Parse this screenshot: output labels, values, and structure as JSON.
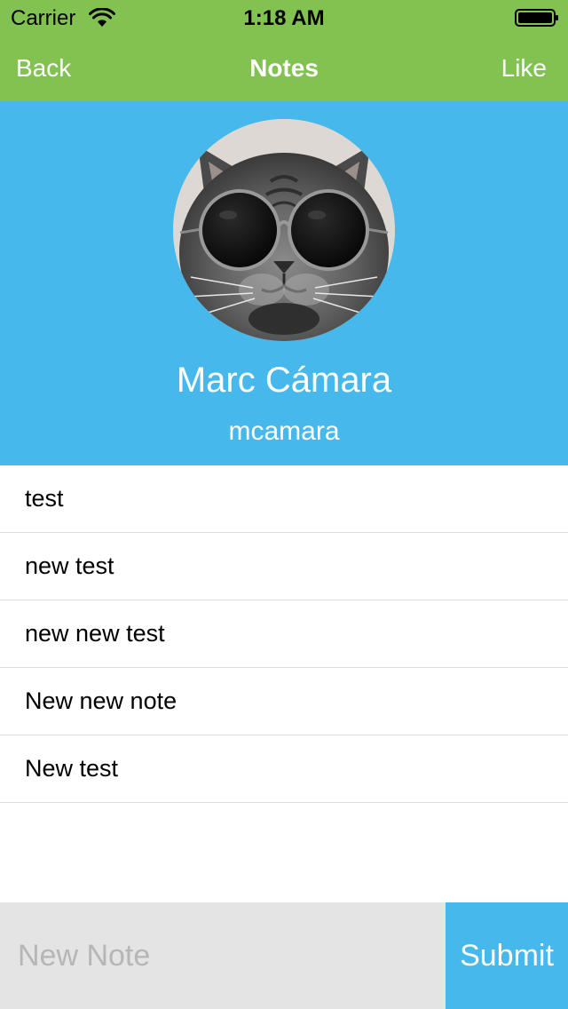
{
  "status_bar": {
    "carrier": "Carrier",
    "time": "1:18 AM",
    "wifi_icon": "wifi-icon",
    "battery_icon": "battery-full-icon"
  },
  "nav": {
    "back_label": "Back",
    "title": "Notes",
    "like_label": "Like"
  },
  "profile": {
    "avatar_icon": "cat-with-sunglasses-avatar",
    "name": "Marc Cámara",
    "username": "mcamara"
  },
  "notes": [
    {
      "text": "test"
    },
    {
      "text": "new test"
    },
    {
      "text": "new new test"
    },
    {
      "text": "New new note"
    },
    {
      "text": "New test"
    }
  ],
  "compose": {
    "placeholder": "New Note",
    "value": "",
    "submit_label": "Submit"
  },
  "colors": {
    "nav_green": "#82c250",
    "header_blue": "#47b8eb",
    "input_gray": "#e4e4e4"
  }
}
